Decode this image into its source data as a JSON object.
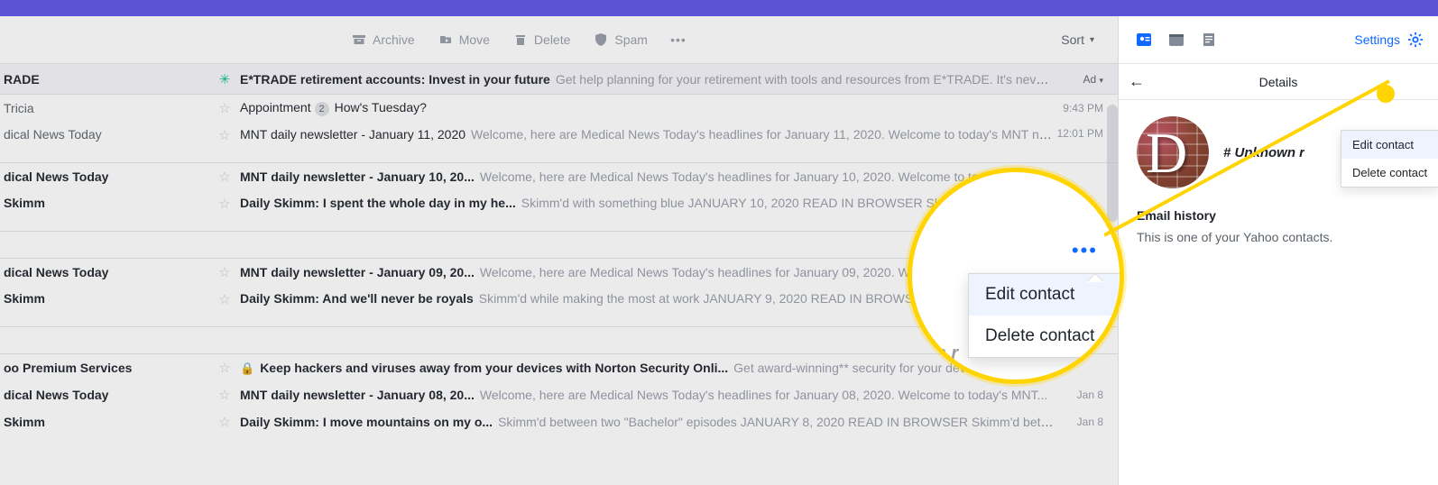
{
  "toolbar": {
    "archive": "Archive",
    "move": "Move",
    "delete": "Delete",
    "spam": "Spam",
    "sort": "Sort"
  },
  "ad_label": "Ad",
  "rows": [
    {
      "sender": "RADE",
      "subject": "E*TRADE retirement accounts: Invest in your future",
      "preview": "Get help planning for your retirement with tools and resources from E*TRADE. It's never...",
      "time": "",
      "ad": true
    },
    {
      "sender": "Tricia",
      "subject": "Appointment",
      "badge": "2",
      "preview2": "How's Tuesday?",
      "time": "9:43 PM"
    },
    {
      "sender": "dical News Today",
      "subject": "MNT daily newsletter - January 11, 2020",
      "preview": "Welcome, here are Medical News Today's headlines for January 11, 2020. Welcome to today's MNT ne...",
      "time": "12:01 PM",
      "group_end": true
    },
    {
      "sender": "dical News Today",
      "subject": "MNT daily newsletter - January 10, 20...",
      "preview": "Welcome, here are Medical News Today's headlines for January 10, 2020. Welcome to today's",
      "time": "",
      "unread": true
    },
    {
      "sender": "Skimm",
      "subject": "Daily Skimm: I spent the whole day in my he...",
      "preview": "Skimm'd with something blue JANUARY 10, 2020 READ IN BROWSER Skimm'd with",
      "time": "",
      "unread": true,
      "group_end": true
    },
    {
      "sender": "dical News Today",
      "subject": "MNT daily newsletter - January 09, 20...",
      "preview": "Welcome, here are Medical News Today's headlines for January 09, 2020. Welcome to to",
      "time": "",
      "unread": true
    },
    {
      "sender": "Skimm",
      "subject": "Daily Skimm: And we'll never be royals",
      "preview": "Skimm'd while making the most at work JANUARY 9, 2020 READ IN BROWSER Skimm'd w",
      "time": "",
      "unread": true,
      "group_end": true
    },
    {
      "sender": "oo Premium Services",
      "subject": "Keep hackers and viruses away from your devices with Norton Security Onli...",
      "preview": "Get award-winning** security for your devices and p",
      "time": "",
      "unread": true,
      "lock": true
    },
    {
      "sender": "dical News Today",
      "subject": "MNT daily newsletter - January 08, 20...",
      "preview": "Welcome, here are Medical News Today's headlines for January 08, 2020. Welcome to today's MNT...",
      "time": "Jan 8",
      "unread": true
    },
    {
      "sender": "Skimm",
      "subject": "Daily Skimm: I move mountains on my o...",
      "preview": "Skimm'd between two \"Bachelor\" episodes JANUARY 8, 2020 READ IN BROWSER Skimm'd betw...",
      "time": "Jan 8",
      "unread": true
    }
  ],
  "right": {
    "settings": "Settings",
    "details": "Details",
    "avatar_letter": "D",
    "contact_name": "# Unknown r",
    "section_title": "Email history",
    "section_text": "This is one of your Yahoo contacts."
  },
  "context_menu": {
    "edit": "Edit contact",
    "delete": "Delete contact"
  },
  "magnifier": {
    "edit": "Edit contact",
    "delete": "Delete contact",
    "ghost": "wn r"
  }
}
